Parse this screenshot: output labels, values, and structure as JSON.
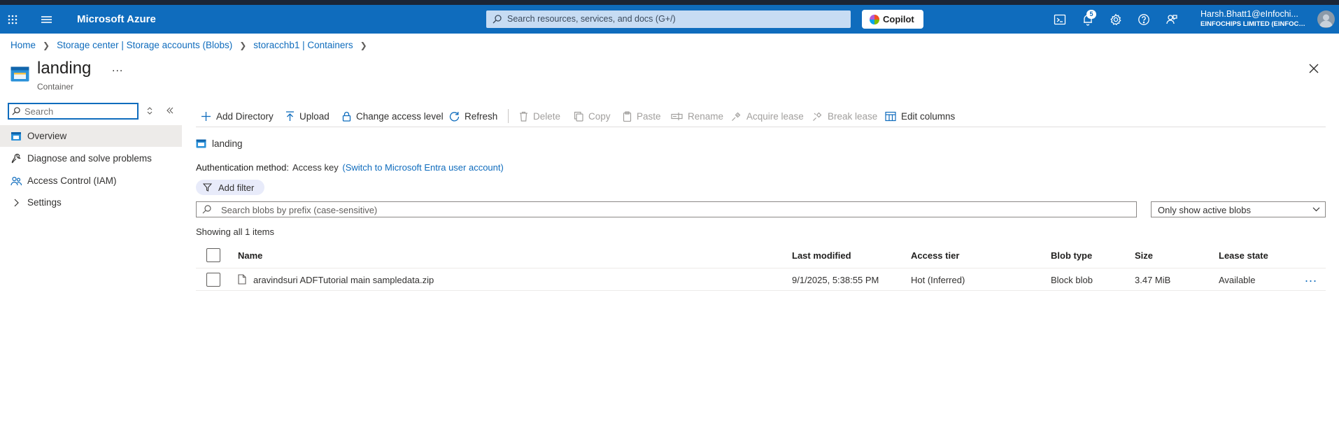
{
  "colors": {
    "topbar": "#0f6cbd",
    "topstrip": "#1b2536",
    "link": "#0f6cbd",
    "nav_active": "#edebe9"
  },
  "topbar": {
    "brand": "Microsoft Azure",
    "search_placeholder": "Search resources, services, and docs (G+/)",
    "copilot_label": "Copilot",
    "notification_count": "5",
    "user_name": "Harsh.Bhatt1@eInfochi...",
    "user_tenant": "EINFOCHIPS LIMITED (EINFOCHI...",
    "icons": [
      "waffle-icon",
      "hamburger-icon",
      "cloud-shell-icon",
      "bell-icon",
      "gear-icon",
      "help-icon",
      "feedback-icon"
    ]
  },
  "breadcrumb": [
    {
      "label": "Home"
    },
    {
      "label": "Storage center | Storage accounts (Blobs)"
    },
    {
      "label": "storacchb1 | Containers"
    }
  ],
  "resource": {
    "title": "landing",
    "subtitle": "Container",
    "more": "...",
    "icon": "container-icon"
  },
  "nav": {
    "search_placeholder": "Search",
    "items": [
      {
        "label": "Overview",
        "icon": "overview-icon",
        "active": true
      },
      {
        "label": "Diagnose and solve problems",
        "icon": "wrench-icon",
        "active": false
      },
      {
        "label": "Access Control (IAM)",
        "icon": "people-icon",
        "active": false
      },
      {
        "label": "Settings",
        "icon": "chevron-right-icon",
        "active": false
      }
    ]
  },
  "toolbar": {
    "add_directory": "Add Directory",
    "upload": "Upload",
    "change_access": "Change access level",
    "refresh": "Refresh",
    "delete": "Delete",
    "copy": "Copy",
    "paste": "Paste",
    "rename": "Rename",
    "acquire_lease": "Acquire lease",
    "break_lease": "Break lease",
    "edit_columns": "Edit columns"
  },
  "content": {
    "path_label": "landing",
    "auth_key": "Authentication method:",
    "auth_value": "Access key",
    "auth_switch": "(Switch to Microsoft Entra user account)",
    "add_filter": "Add filter",
    "blob_search_placeholder": "Search blobs by prefix (case-sensitive)",
    "filter_dropdown": "Only show active blobs",
    "showing": "Showing all 1 items"
  },
  "grid": {
    "columns": [
      "Name",
      "Last modified",
      "Access tier",
      "Blob type",
      "Size",
      "Lease state"
    ],
    "rows": [
      {
        "name": "aravindsuri ADFTutorial main sampledata.zip",
        "last_modified": "9/1/2025, 5:38:55 PM",
        "access_tier": "Hot (Inferred)",
        "blob_type": "Block blob",
        "size": "3.47 MiB",
        "lease_state": "Available",
        "more": "..."
      }
    ]
  }
}
